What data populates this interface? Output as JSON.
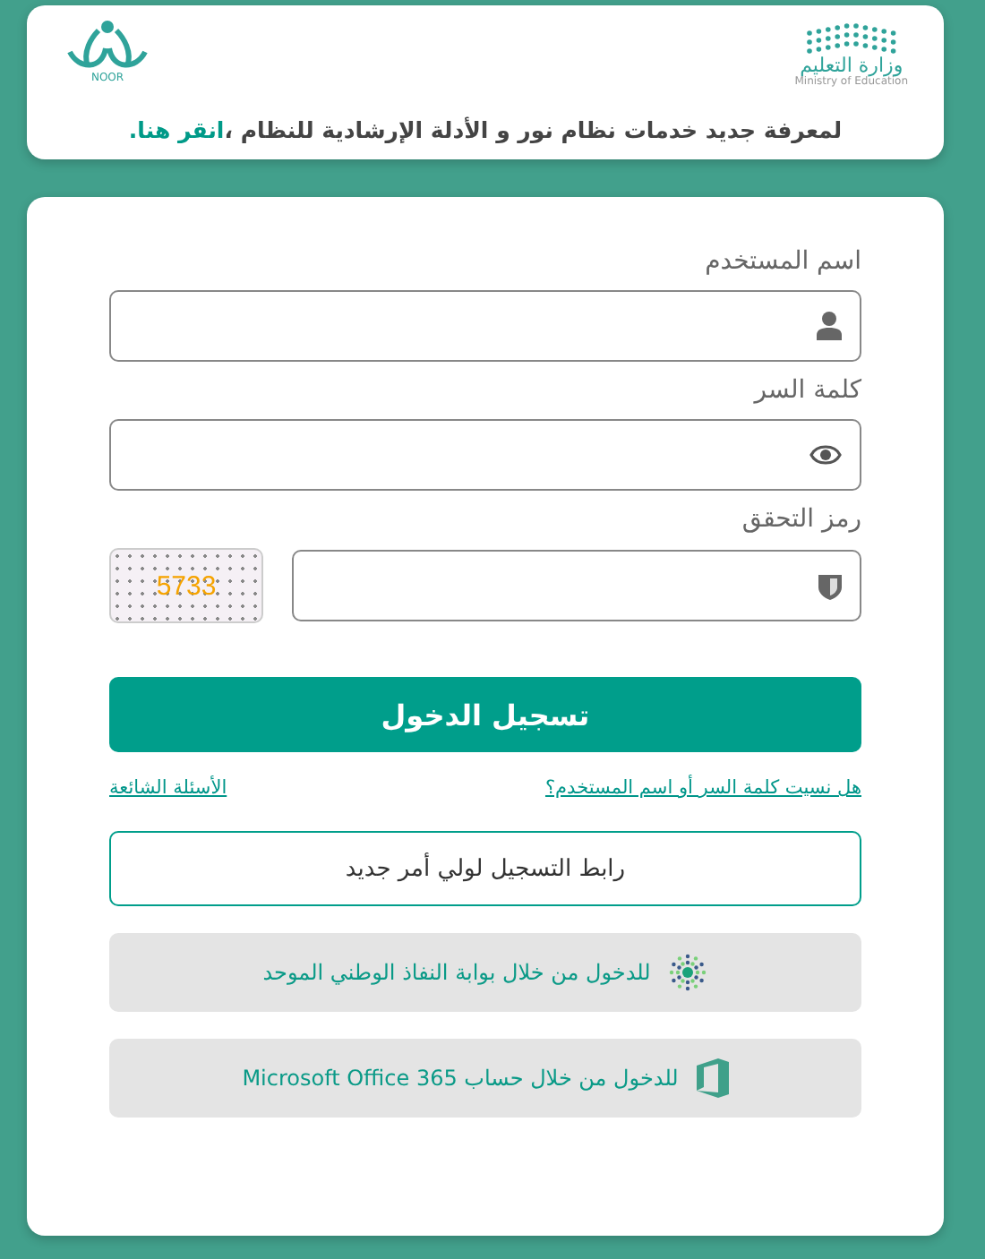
{
  "header": {
    "ministry_logo": {
      "arabic": "وزارة التعليم",
      "english": "Ministry of Education"
    },
    "noor_logo": {
      "text": "NOOR"
    },
    "notice": {
      "text": "لمعرفة جديد خدمات نظام نور و الأدلة الإرشادية للنظام ،",
      "link": "انقر هنا."
    }
  },
  "form": {
    "fields": [
      {
        "label": "اسم المستخدم",
        "kind": "user"
      },
      {
        "label": "كلمة السر",
        "kind": "eye"
      },
      {
        "label": "رمز التحقق",
        "kind": "shield",
        "captcha": "5733"
      }
    ],
    "submit": "تسجيل الدخول",
    "links": [
      "هل نسيت كلمة السر أو اسم المستخدم؟",
      "الأسئلة الشائعة"
    ],
    "register": "رابط التسجيل لولي أمر جديد",
    "alt_logins": [
      {
        "label": "للدخول من خلال بوابة النفاذ الوطني الموحد",
        "kind": "nafath"
      },
      {
        "label": "للدخول من خلال حساب Microsoft Office 365",
        "kind": "office"
      }
    ]
  }
}
